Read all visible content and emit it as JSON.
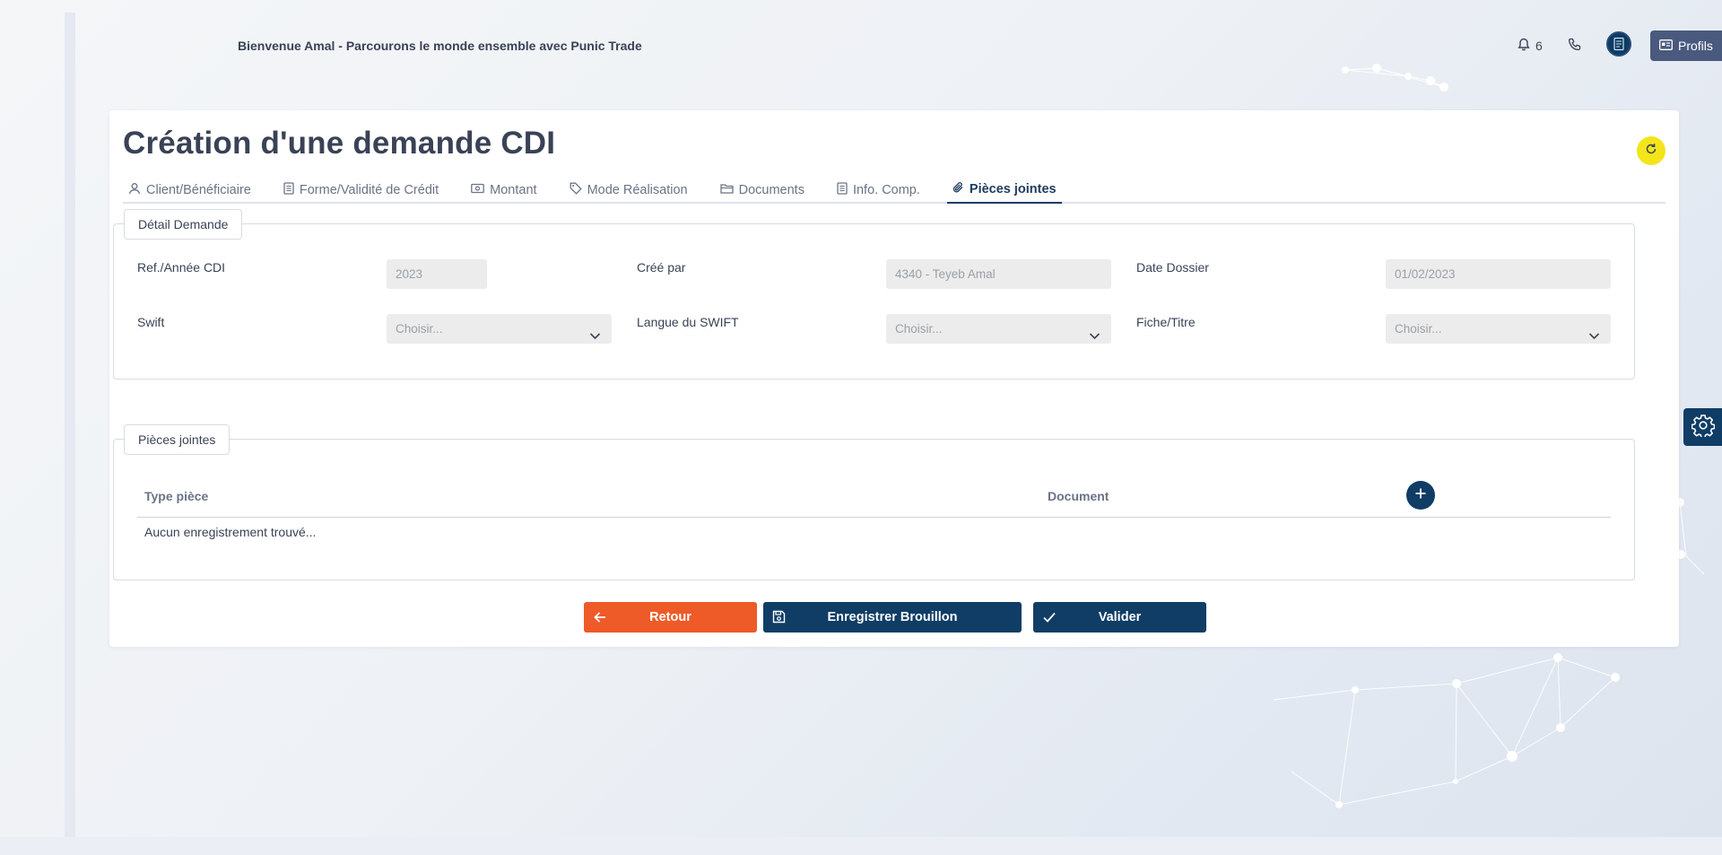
{
  "header": {
    "welcome_text": "Bienvenue Amal - Parcourons le monde ensemble avec Punic Trade",
    "notification_count": "6",
    "profils_label": "Profils"
  },
  "page": {
    "title": "Création d'une demande CDI"
  },
  "tabs": [
    {
      "label": "Client/Bénéficiaire",
      "icon": "user-icon",
      "active": false
    },
    {
      "label": "Forme/Validité de Crédit",
      "icon": "document-icon",
      "active": false
    },
    {
      "label": "Montant",
      "icon": "money-icon",
      "active": false
    },
    {
      "label": "Mode Réalisation",
      "icon": "tag-icon",
      "active": false
    },
    {
      "label": "Documents",
      "icon": "folder-icon",
      "active": false
    },
    {
      "label": "Info. Comp.",
      "icon": "document-icon",
      "active": false
    },
    {
      "label": "Pièces jointes",
      "icon": "paperclip-icon",
      "active": true
    }
  ],
  "detail": {
    "legend": "Détail Demande",
    "ref_label": "Ref./Année CDI",
    "ref_value": "2023",
    "cree_par_label": "Créé par",
    "cree_par_value": "4340 - Teyeb Amal",
    "date_label": "Date Dossier",
    "date_value": "01/02/2023",
    "swift_label": "Swift",
    "swift_value": "Choisir...",
    "langue_label": "Langue du SWIFT",
    "langue_value": "Choisir...",
    "fiche_label": "Fiche/Titre",
    "fiche_value": "Choisir..."
  },
  "attachments": {
    "legend": "Pièces jointes",
    "columns": [
      "Type pièce",
      "Document"
    ],
    "empty_message": "Aucun enregistrement trouvé..."
  },
  "actions": {
    "retour": "Retour",
    "brouillon": "Enregistrer Brouillon",
    "valider": "Valider"
  },
  "colors": {
    "primary": "#0f3d66",
    "danger": "#ee5a28",
    "refresh": "#f3e51a"
  }
}
